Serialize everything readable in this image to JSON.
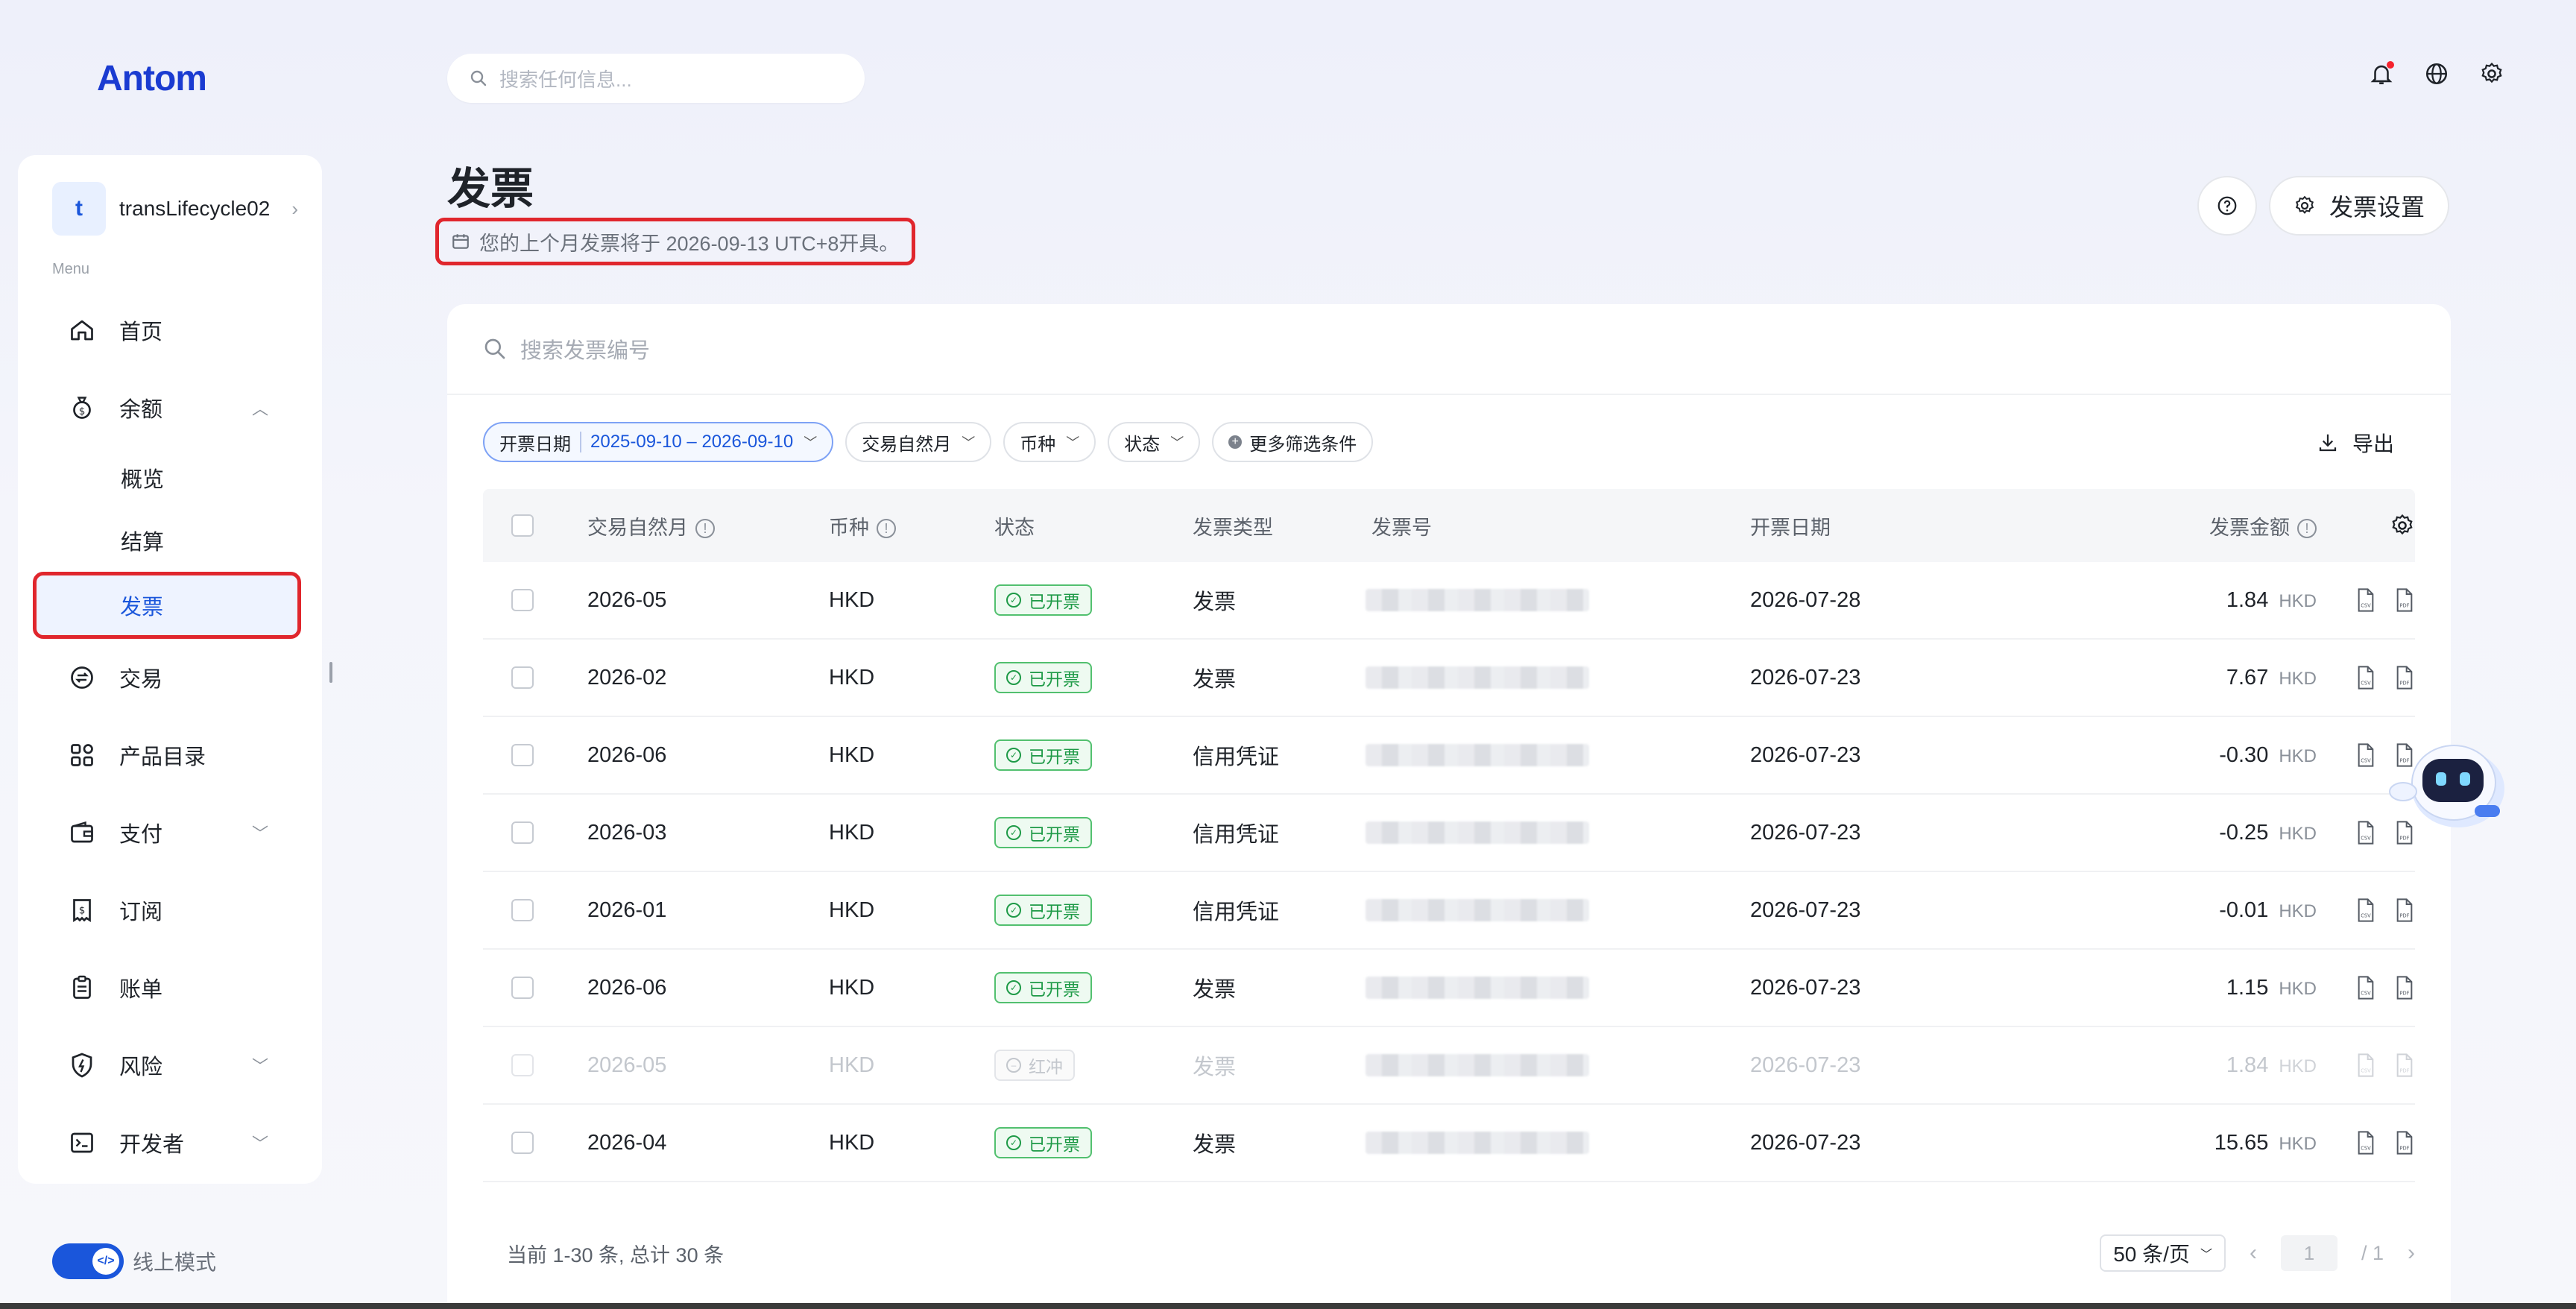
{
  "brand": {
    "logo": "Antom"
  },
  "top_search": {
    "placeholder": "搜索任何信息..."
  },
  "account": {
    "avatar": "t",
    "name": "transLifecycle02"
  },
  "sidebar": {
    "caption": "Menu",
    "items": [
      {
        "label": "首页"
      },
      {
        "label": "余额",
        "subitems": [
          "概览",
          "结算",
          "发票"
        ]
      },
      {
        "label": "交易"
      },
      {
        "label": "产品目录"
      },
      {
        "label": "支付"
      },
      {
        "label": "订阅"
      },
      {
        "label": "账单"
      },
      {
        "label": "风险"
      },
      {
        "label": "开发者"
      }
    ],
    "mode_label": "线上模式"
  },
  "page": {
    "title": "发票",
    "notice": "您的上个月发票将于 2026-09-13 UTC+8开具。",
    "settings_button": "发票设置"
  },
  "card": {
    "search_placeholder": "搜索发票编号",
    "filters": {
      "date_label": "开票日期",
      "date_value": "2025-09-10 – 2026-09-10",
      "month": "交易自然月",
      "currency": "币种",
      "status": "状态",
      "more": "更多筛选条件"
    },
    "export_label": "导出",
    "columns": [
      "交易自然月",
      "币种",
      "状态",
      "发票类型",
      "发票号",
      "开票日期",
      "发票金额"
    ],
    "rows": [
      {
        "month": "2026-05",
        "currency": "HKD",
        "status": "已开票",
        "type": "发票",
        "date": "2026-07-28",
        "amount": "1.84",
        "unit": "HKD"
      },
      {
        "month": "2026-02",
        "currency": "HKD",
        "status": "已开票",
        "type": "发票",
        "date": "2026-07-23",
        "amount": "7.67",
        "unit": "HKD"
      },
      {
        "month": "2026-06",
        "currency": "HKD",
        "status": "已开票",
        "type": "信用凭证",
        "date": "2026-07-23",
        "amount": "-0.30",
        "unit": "HKD"
      },
      {
        "month": "2026-03",
        "currency": "HKD",
        "status": "已开票",
        "type": "信用凭证",
        "date": "2026-07-23",
        "amount": "-0.25",
        "unit": "HKD"
      },
      {
        "month": "2026-01",
        "currency": "HKD",
        "status": "已开票",
        "type": "信用凭证",
        "date": "2026-07-23",
        "amount": "-0.01",
        "unit": "HKD"
      },
      {
        "month": "2026-06",
        "currency": "HKD",
        "status": "已开票",
        "type": "发票",
        "date": "2026-07-23",
        "amount": "1.15",
        "unit": "HKD"
      },
      {
        "month": "2026-05",
        "currency": "HKD",
        "status": "红冲",
        "type": "发票",
        "date": "2026-07-23",
        "amount": "1.84",
        "unit": "HKD"
      },
      {
        "month": "2026-04",
        "currency": "HKD",
        "status": "已开票",
        "type": "发票",
        "date": "2026-07-23",
        "amount": "15.65",
        "unit": "HKD"
      }
    ],
    "footer": {
      "summary": "当前 1-30 条, 总计 30 条",
      "page_size": "50 条/页",
      "current_page": "1",
      "total_pages": "/ 1"
    }
  },
  "colors": {
    "accent": "#1a56db",
    "highlight": "#e0262d",
    "success": "#1e9a47"
  },
  "icons": [
    "search-icon",
    "bell-icon",
    "globe-icon",
    "gear-icon",
    "home-icon",
    "money-bag-icon",
    "exchange-icon",
    "grid-icon",
    "wallet-icon",
    "subscription-icon",
    "bill-icon",
    "shield-icon",
    "terminal-icon",
    "calendar-icon",
    "help-icon",
    "download-icon",
    "csv-file-icon",
    "pdf-file-icon",
    "robot-assistant-icon"
  ]
}
